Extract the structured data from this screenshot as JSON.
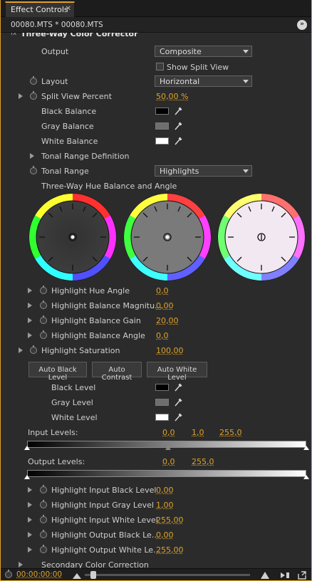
{
  "tab": {
    "title": "Effect Controls",
    "close": "✕"
  },
  "clip": {
    "title": "00080.MTS * 00080.MTS",
    "nav": "»"
  },
  "effect": {
    "title": "Three-Way Color Corrector",
    "fx": "fx"
  },
  "rows": {
    "output": {
      "label": "Output",
      "value": "Composite"
    },
    "show_split": {
      "label": "Show Split View"
    },
    "layout": {
      "label": "Layout",
      "value": "Horizontal"
    },
    "split_percent": {
      "label": "Split View Percent",
      "value": "50,00 %"
    },
    "black_balance": {
      "label": "Black Balance",
      "color": "#000000"
    },
    "gray_balance": {
      "label": "Gray Balance",
      "color": "#6e6e6e"
    },
    "white_balance": {
      "label": "White Balance",
      "color": "#ffffff"
    },
    "tonal_def": {
      "label": "Tonal Range Definition"
    },
    "tonal_range": {
      "label": "Tonal Range",
      "value": "Highlights"
    },
    "wheels_title": {
      "label": "Three-Way Hue Balance and Angle"
    },
    "hue_angle": {
      "label": "Highlight Hue Angle",
      "value": "0,0"
    },
    "bal_mag": {
      "label": "Highlight Balance Magnitu...",
      "value": "0,00"
    },
    "bal_gain": {
      "label": "Highlight Balance Gain",
      "value": "20,00"
    },
    "bal_angle": {
      "label": "Highlight Balance Angle",
      "value": "0,0"
    },
    "saturation": {
      "label": "Highlight Saturation",
      "value": "100,00"
    },
    "black_level": {
      "label": "Black Level",
      "color": "#000000"
    },
    "gray_level": {
      "label": "Gray Level",
      "color": "#6e6e6e"
    },
    "white_level": {
      "label": "White Level",
      "color": "#ffffff"
    },
    "input_levels": {
      "label": "Input Levels:",
      "v1": "0,0",
      "v2": "1,0",
      "v3": "255,0"
    },
    "output_levels": {
      "label": "Output Levels:",
      "v1": "0,0",
      "v2": "255,0"
    },
    "in_black": {
      "label": "Highlight Input Black Level",
      "value": "0,00"
    },
    "in_gray": {
      "label": "Highlight Input Gray Level",
      "value": "1,00"
    },
    "in_white": {
      "label": "Highlight Input White Level",
      "value": "255,00"
    },
    "out_black": {
      "label": "Highlight Output Black Le...",
      "value": "0,00"
    },
    "out_white": {
      "label": "Highlight Output White Le...",
      "value": "255,00"
    },
    "secondary": {
      "label": "Secondary Color Correction"
    }
  },
  "buttons": {
    "auto_black": "Auto Black Level",
    "auto_contrast": "Auto Contrast",
    "auto_white": "Auto White Level"
  },
  "footer": {
    "timecode": "00:00:00:00"
  },
  "colors": {
    "accent": "#e0a22a",
    "background": "#2b2b2b"
  }
}
